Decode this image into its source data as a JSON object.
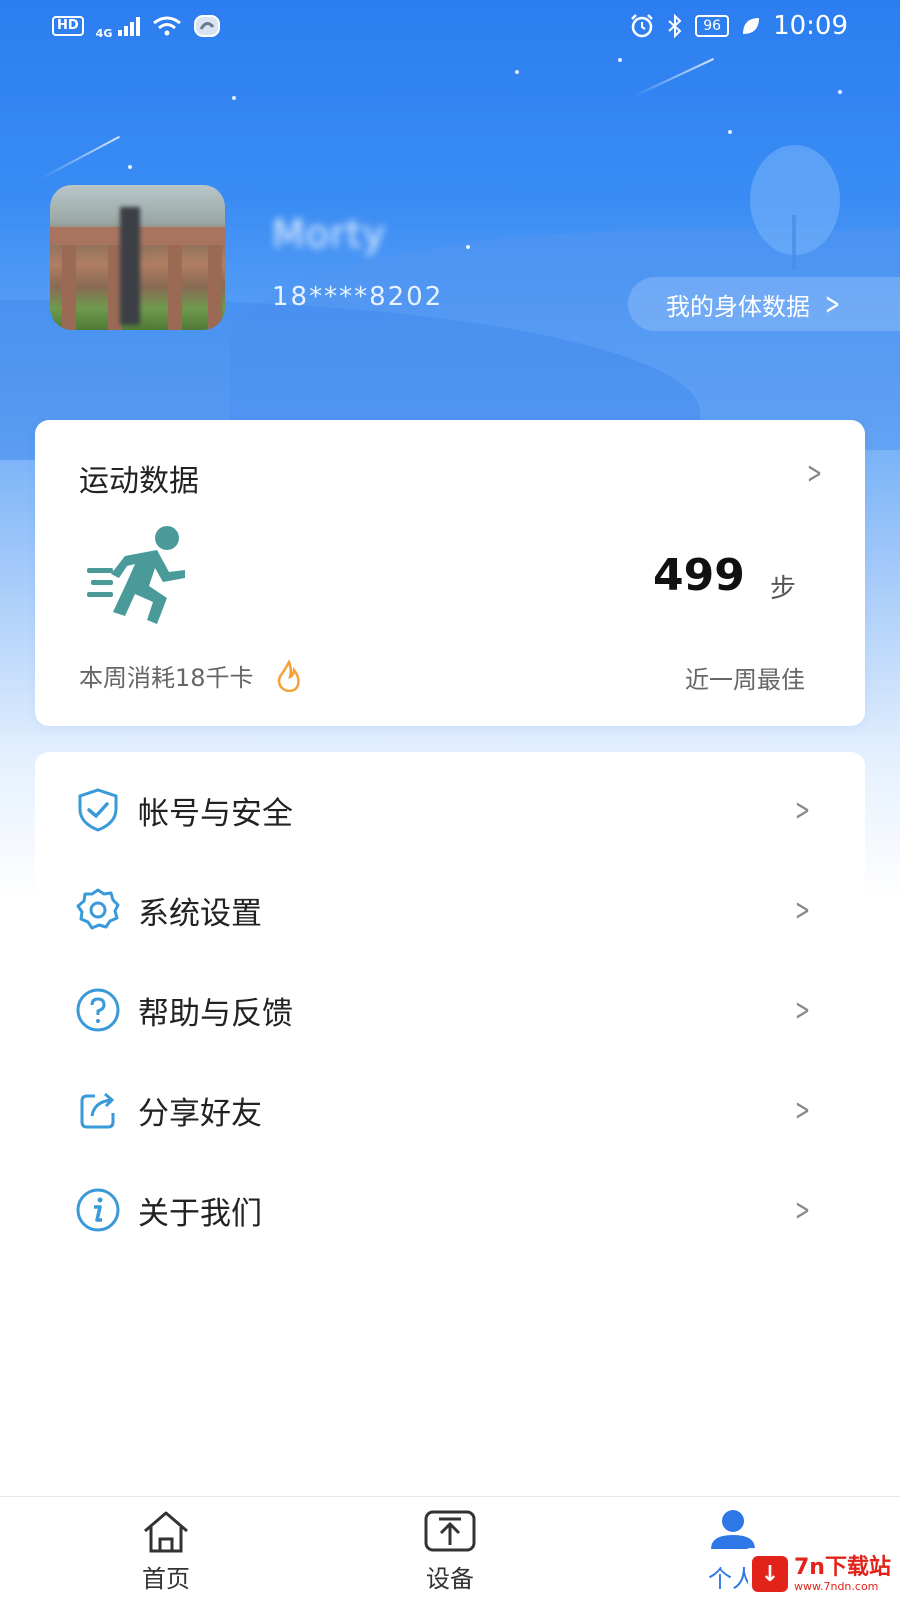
{
  "status_bar": {
    "hd": "HD",
    "network": "4G",
    "battery": "96",
    "time": "10:09"
  },
  "profile": {
    "name": "Morty",
    "phone": "18****8202",
    "body_data_label": "我的身体数据"
  },
  "sport_card": {
    "title": "运动数据",
    "steps_value": "499",
    "steps_unit": "步",
    "week_calories": "本周消耗18千卡",
    "week_best": "近一周最佳"
  },
  "menu": {
    "items": [
      {
        "label": "帐号与安全",
        "icon": "shield-check-icon"
      },
      {
        "label": "系统设置",
        "icon": "gear-icon"
      },
      {
        "label": "帮助与反馈",
        "icon": "help-circle-icon"
      },
      {
        "label": "分享好友",
        "icon": "share-icon"
      },
      {
        "label": "关于我们",
        "icon": "info-circle-icon"
      }
    ]
  },
  "tab_bar": {
    "tabs": [
      {
        "label": "首页",
        "icon": "home-icon"
      },
      {
        "label": "设备",
        "icon": "device-upload-icon"
      },
      {
        "label": "个人",
        "icon": "person-icon",
        "active": true
      }
    ]
  },
  "watermark": {
    "title": "7n下载站",
    "url": "www.7ndn.com"
  },
  "colors": {
    "accent": "#2d78e6",
    "icon_blue": "#3a9ad9",
    "runner_teal": "#4a9a9a",
    "flame_orange": "#f3a23a"
  }
}
